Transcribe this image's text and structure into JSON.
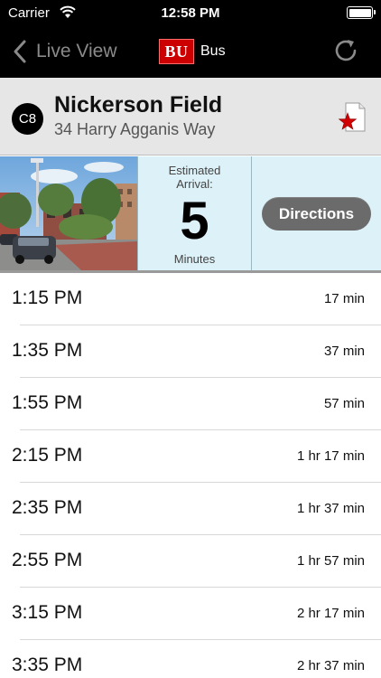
{
  "status_bar": {
    "carrier": "Carrier",
    "time": "12:58 PM",
    "battery_level": 1.0
  },
  "nav": {
    "back_label": "Live View",
    "logo_text": "BU",
    "title": "Bus",
    "refresh_icon": "refresh-icon"
  },
  "stop": {
    "route": "C8",
    "name": "Nickerson Field",
    "address": "34 Harry Agganis Way",
    "favorite_icon": "favorite-star-icon"
  },
  "arrival": {
    "label": "Estimated Arrival:",
    "value": "5",
    "unit": "Minutes"
  },
  "directions_label": "Directions",
  "departures": [
    {
      "time": "1:15 PM",
      "wait": "17 min"
    },
    {
      "time": "1:35 PM",
      "wait": "37 min"
    },
    {
      "time": "1:55 PM",
      "wait": "57 min"
    },
    {
      "time": "2:15 PM",
      "wait": "1 hr 17 min"
    },
    {
      "time": "2:35 PM",
      "wait": "1 hr 37 min"
    },
    {
      "time": "2:55 PM",
      "wait": "1 hr 57 min"
    },
    {
      "time": "3:15 PM",
      "wait": "2 hr 17 min"
    },
    {
      "time": "3:35 PM",
      "wait": "2 hr 37 min"
    }
  ],
  "colors": {
    "bar_background": "#000000",
    "logo_red": "#cc0000",
    "arrival_panel": "#ddf1f8",
    "button_gray": "#6b6b6b",
    "favorite_red": "#d10000"
  }
}
